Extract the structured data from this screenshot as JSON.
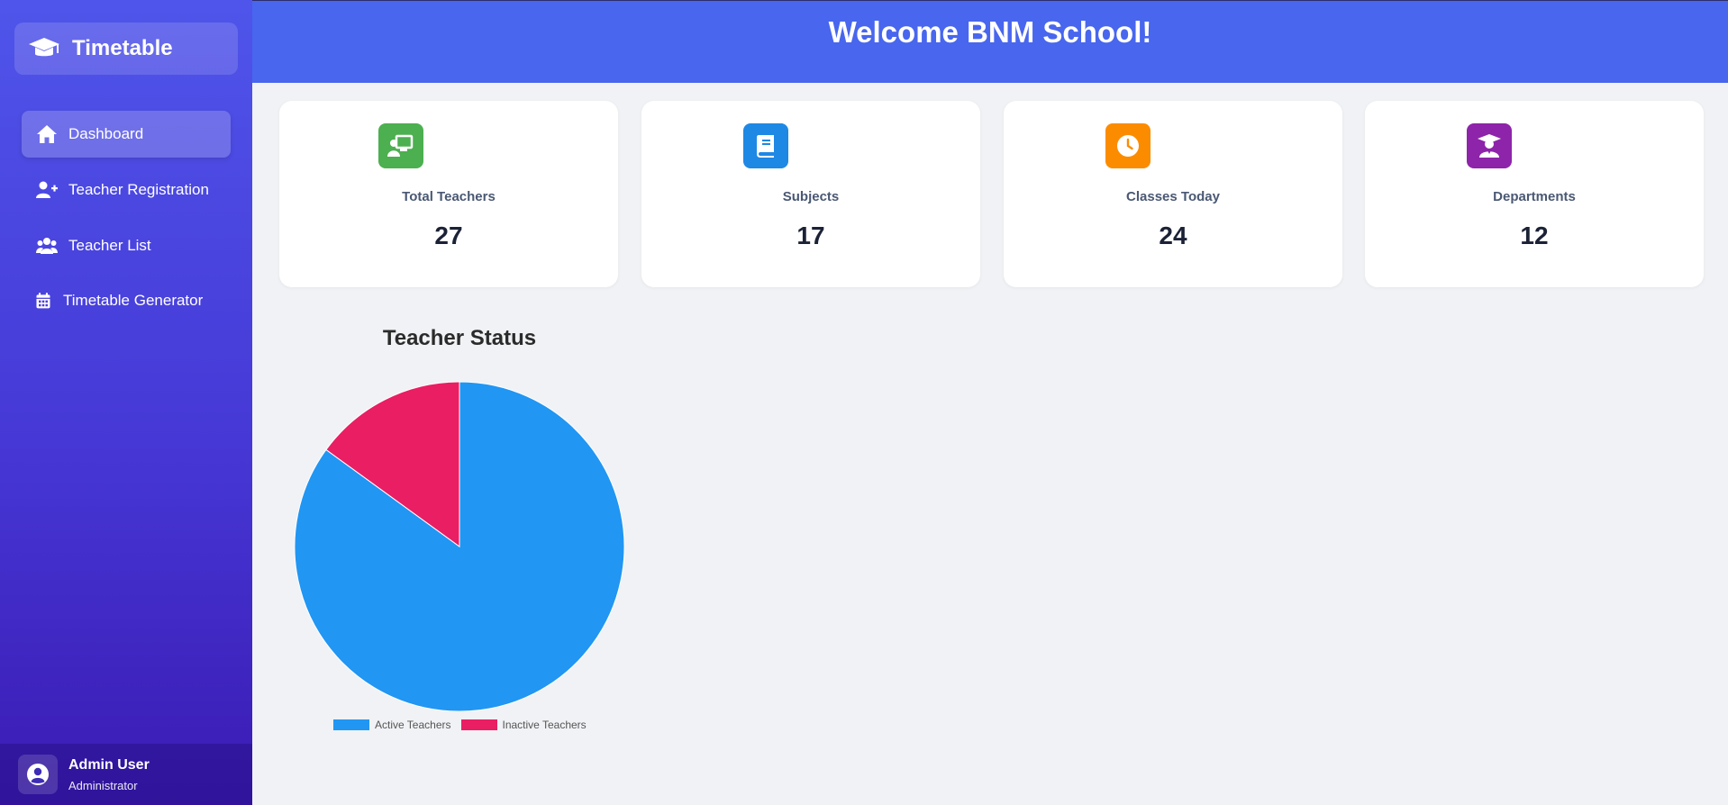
{
  "sidebar": {
    "brand": "Timetable",
    "items": [
      {
        "label": "Dashboard",
        "icon": "home-icon"
      },
      {
        "label": "Teacher Registration",
        "icon": "user-plus-icon"
      },
      {
        "label": "Teacher List",
        "icon": "users-icon"
      },
      {
        "label": "Timetable Generator",
        "icon": "calendar-icon"
      }
    ],
    "user": {
      "name": "Admin User",
      "role": "Administrator"
    }
  },
  "header": {
    "title": "Welcome BNM School!"
  },
  "stats": [
    {
      "label": "Total Teachers",
      "value": "27",
      "icon": "chalkboard-teacher-icon",
      "color": "#4caf50"
    },
    {
      "label": "Subjects",
      "value": "17",
      "icon": "book-icon",
      "color": "#1e88e5"
    },
    {
      "label": "Classes Today",
      "value": "24",
      "icon": "clock-icon",
      "color": "#fb8c00"
    },
    {
      "label": "Departments",
      "value": "12",
      "icon": "graduate-icon",
      "color": "#8e24aa"
    }
  ],
  "chart_data": {
    "type": "pie",
    "title": "Teacher Status",
    "categories": [
      "Active Teachers",
      "Inactive Teachers"
    ],
    "values": [
      85,
      15
    ],
    "colors": [
      "#2196f3",
      "#e91e63"
    ],
    "legend": "bottom"
  }
}
